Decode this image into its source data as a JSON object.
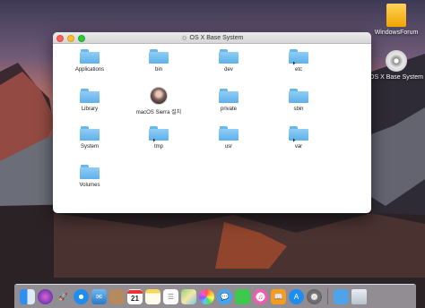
{
  "desktop": {
    "icons": [
      {
        "label": "WindowsForum"
      },
      {
        "label": "OS X Base System"
      }
    ]
  },
  "window": {
    "title": "OS X Base System",
    "items": [
      {
        "label": "Applications",
        "kind": "folder"
      },
      {
        "label": "bin",
        "kind": "folder"
      },
      {
        "label": "dev",
        "kind": "folder"
      },
      {
        "label": "etc",
        "kind": "alias-folder"
      },
      {
        "label": "Library",
        "kind": "folder"
      },
      {
        "label": "macOS Sierra 설치",
        "kind": "app"
      },
      {
        "label": "private",
        "kind": "folder"
      },
      {
        "label": "sbin",
        "kind": "folder"
      },
      {
        "label": "System",
        "kind": "folder"
      },
      {
        "label": "tmp",
        "kind": "alias-folder"
      },
      {
        "label": "usr",
        "kind": "folder"
      },
      {
        "label": "var",
        "kind": "alias-folder"
      },
      {
        "label": "Volumes",
        "kind": "folder"
      }
    ]
  },
  "dock": {
    "calendar_day": "21",
    "apps": [
      "finder-icon",
      "siri-icon",
      "launchpad-icon",
      "safari-icon",
      "mail-icon",
      "contacts-icon",
      "calendar-icon",
      "notes-icon",
      "reminders-icon",
      "maps-icon",
      "photos-icon",
      "messages-icon",
      "facetime-icon",
      "itunes-icon",
      "ibooks-icon",
      "app-store-icon",
      "system-preferences-icon",
      "downloads-icon",
      "trash-icon"
    ]
  }
}
